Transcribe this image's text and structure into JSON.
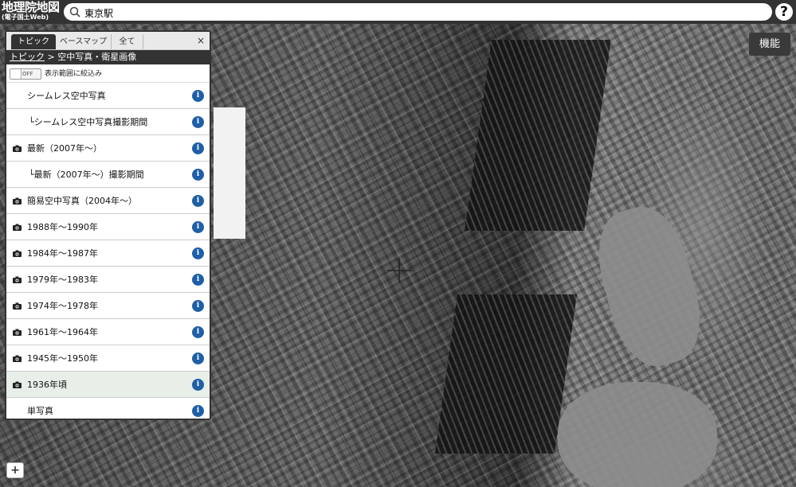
{
  "app": {
    "logo_main": "地理院地図",
    "logo_sub": "(電子国土Web)"
  },
  "search": {
    "value": "東京駅",
    "icon": "search-icon"
  },
  "help_label": "?",
  "functions_button": "機能",
  "zoom": {
    "in": "+",
    "out": "−"
  },
  "panel": {
    "tabs": [
      {
        "label": "トピック",
        "active": true
      },
      {
        "label": "ベースマップ",
        "active": false
      },
      {
        "label": "全て",
        "active": false
      }
    ],
    "close_label": "×",
    "breadcrumb": {
      "root": "トピック",
      "sep": ">",
      "current": "空中写真・衛星画像"
    },
    "filter": {
      "toggle_state": "OFF",
      "label": "表示範囲に絞込み"
    },
    "items": [
      {
        "label": "シームレス空中写真",
        "camera": false,
        "indent": 1,
        "info": "i"
      },
      {
        "label": "└シームレス空中写真撮影期間",
        "camera": false,
        "indent": 2,
        "info": "i"
      },
      {
        "label": "最新（2007年～）",
        "camera": true,
        "indent": 0,
        "info": "i"
      },
      {
        "label": "└最新（2007年～）撮影期間",
        "camera": false,
        "indent": 2,
        "info": "i"
      },
      {
        "label": "簡易空中写真（2004年～）",
        "camera": true,
        "indent": 0,
        "info": "i"
      },
      {
        "label": "1988年～1990年",
        "camera": true,
        "indent": 0,
        "info": "i"
      },
      {
        "label": "1984年～1987年",
        "camera": true,
        "indent": 0,
        "info": "i"
      },
      {
        "label": "1979年～1983年",
        "camera": true,
        "indent": 0,
        "info": "i"
      },
      {
        "label": "1974年～1978年",
        "camera": true,
        "indent": 0,
        "info": "i"
      },
      {
        "label": "1961年～1964年",
        "camera": true,
        "indent": 0,
        "info": "i"
      },
      {
        "label": "1945年～1950年",
        "camera": true,
        "indent": 0,
        "info": "i"
      },
      {
        "label": "1936年頃",
        "camera": true,
        "indent": 0,
        "info": "i",
        "selected": true
      },
      {
        "label": "単写真",
        "camera": false,
        "indent": 1,
        "info": "i"
      }
    ]
  },
  "colors": {
    "header_bg": "#333333",
    "info_icon": "#1f5fa6",
    "selected_row": "#e7efe8"
  }
}
